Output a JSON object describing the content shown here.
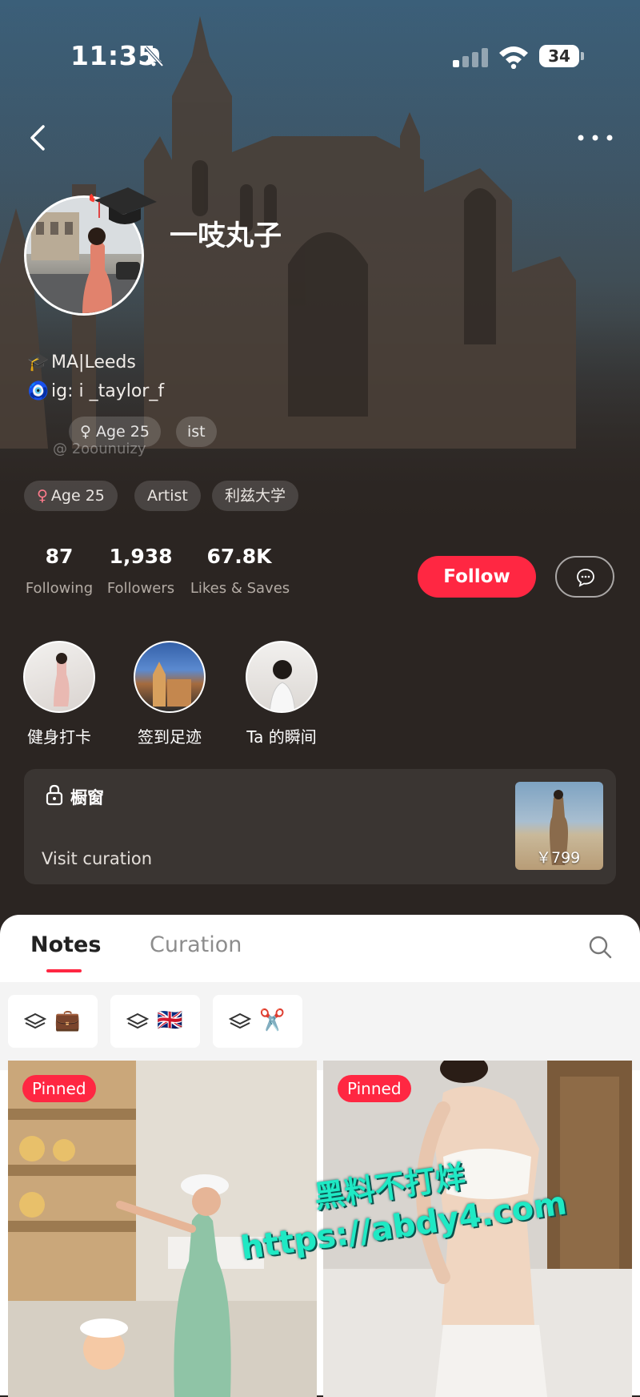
{
  "status_bar": {
    "time": "11:35",
    "battery": "34"
  },
  "profile": {
    "username": "一吱丸子",
    "bio_lines": [
      {
        "emoji": "🎓",
        "text": "MA|Leeds"
      },
      {
        "emoji": "🧿",
        "text": "ig: i _taylor_f"
      }
    ],
    "ghost_tags": [
      "♀ Age 25",
      "ist"
    ],
    "ghost_text": "@ 2oounuizy",
    "tags": [
      {
        "icon": "female-icon",
        "symbol": "♀",
        "label": "Age 25"
      },
      {
        "label": "Artist"
      },
      {
        "label": "利兹大学"
      }
    ],
    "stats": [
      {
        "value": "87",
        "label": "Following"
      },
      {
        "value": "1,938",
        "label": "Followers"
      },
      {
        "value": "67.8K",
        "label": "Likes & Saves"
      }
    ],
    "follow_label": "Follow"
  },
  "highlights": [
    {
      "label": "健身打卡"
    },
    {
      "label": "签到足迹"
    },
    {
      "label": "Ta 的瞬间"
    }
  ],
  "shop": {
    "title": "橱窗",
    "link": "Visit curation",
    "price": "￥799"
  },
  "tabs": {
    "notes": "Notes",
    "curation": "Curation"
  },
  "filters": [
    {
      "emoji": "💼",
      "icon": "briefcase-icon"
    },
    {
      "emoji": "🇬🇧",
      "icon": "uk-flag-icon"
    },
    {
      "emoji": "✂️",
      "icon": "scissors-icon"
    }
  ],
  "notes": [
    {
      "badge": "Pinned"
    },
    {
      "badge": "Pinned"
    }
  ],
  "watermark": {
    "line1": "黑料不打烊",
    "line2": "https://abdy4.com"
  },
  "colors": {
    "accent": "#ff2742",
    "sheet": "#ffffff",
    "background": "#2b2522"
  }
}
